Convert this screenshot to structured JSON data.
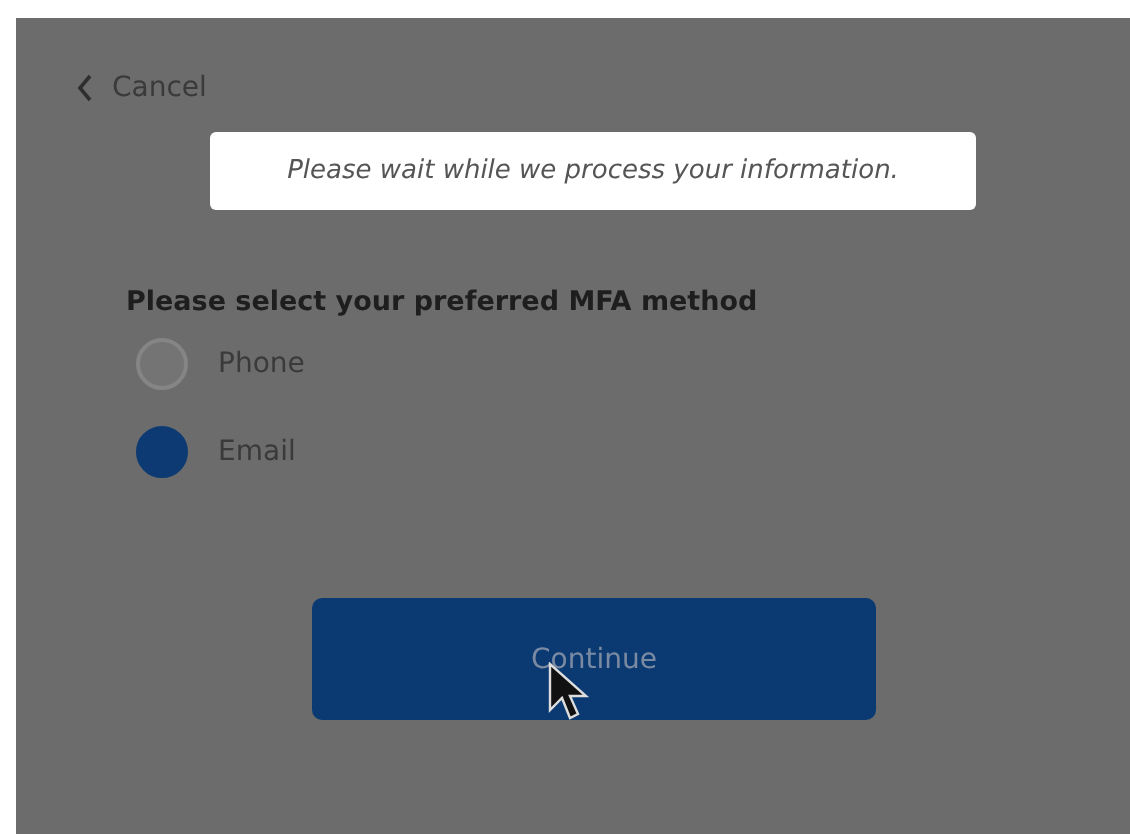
{
  "back_link": {
    "label": "Cancel"
  },
  "notice": {
    "text": "Please wait while we process your information."
  },
  "mfa": {
    "heading": "Please select your preferred MFA method",
    "options": [
      {
        "label": "Phone",
        "selected": false
      },
      {
        "label": "Email",
        "selected": true
      }
    ]
  },
  "continue_button": {
    "label": "Continue"
  }
}
